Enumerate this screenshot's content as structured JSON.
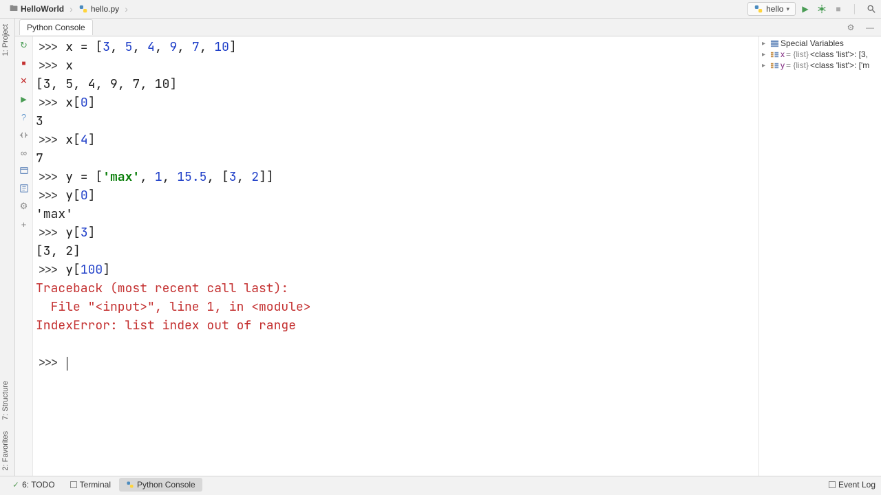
{
  "breadcrumb": {
    "project": "HelloWorld",
    "file": "hello.py"
  },
  "runConfig": {
    "name": "hello"
  },
  "consoleTab": "Python Console",
  "sideTabs": {
    "project": "1: Project",
    "structure": "7: Structure",
    "favorites": "2: Favorites"
  },
  "varsPanel": {
    "special": "Special Variables",
    "x_name": "x",
    "x_type": " = {list} ",
    "x_val": "<class 'list'>: [3,",
    "y_name": "y",
    "y_type": " = {list} ",
    "y_val": "<class 'list'>: ['m"
  },
  "bottom": {
    "todo": "6: TODO",
    "terminal": "Terminal",
    "pyconsole": "Python Console",
    "eventLog": "Event Log"
  },
  "console": {
    "l1_prompt": ">>> ",
    "l1_a": "x = [",
    "l1_n1": "3",
    "l1_c1": ", ",
    "l1_n2": "5",
    "l1_c2": ", ",
    "l1_n3": "4",
    "l1_c3": ", ",
    "l1_n4": "9",
    "l1_c4": ", ",
    "l1_n5": "7",
    "l1_c5": ", ",
    "l1_n6": "10",
    "l1_e": "]",
    "l2_prompt": ">>> ",
    "l2_a": "x",
    "l3": "[3, 5, 4, 9, 7, 10]",
    "l4_prompt": ">>> ",
    "l4_a": "x[",
    "l4_n": "0",
    "l4_e": "]",
    "l5": "3",
    "l6_prompt": ">>> ",
    "l6_a": "x[",
    "l6_n": "4",
    "l6_e": "]",
    "l7": "7",
    "l8_prompt": ">>> ",
    "l8_a": "y = [",
    "l8_s": "'max'",
    "l8_c1": ", ",
    "l8_n1": "1",
    "l8_c2": ", ",
    "l8_n2": "15.5",
    "l8_c3": ", [",
    "l8_n3": "3",
    "l8_c4": ", ",
    "l8_n4": "2",
    "l8_e": "]]",
    "l9_prompt": ">>> ",
    "l9_a": "y[",
    "l9_n": "0",
    "l9_e": "]",
    "l10": "'max'",
    "l11_prompt": ">>> ",
    "l11_a": "y[",
    "l11_n": "3",
    "l11_e": "]",
    "l12": "[3, 2]",
    "l13_prompt": ">>> ",
    "l13_a": "y[",
    "l13_n": "100",
    "l13_e": "]",
    "l14": "Traceback (most recent call last):",
    "l15": "  File \"<input>\", line 1, in <module>",
    "l16": "IndexError: list index out of range",
    "l17_prompt": ">>> "
  }
}
